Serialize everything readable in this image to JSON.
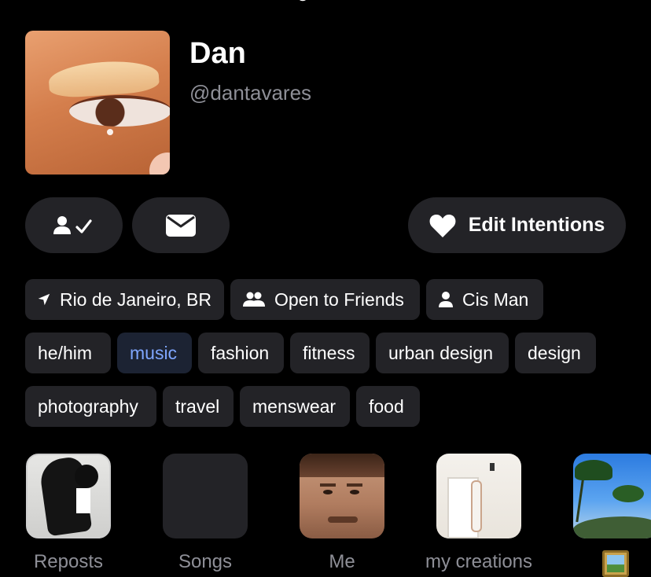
{
  "profile": {
    "name": "Dan",
    "handle": "@dantavares"
  },
  "actions": {
    "edit_intentions_label": "Edit Intentions"
  },
  "icons": {
    "follow": "person-check-icon",
    "message": "envelope-icon",
    "edit_intentions": "heart-icon",
    "location": "location-arrow-icon",
    "friends": "people-icon",
    "gender": "person-icon"
  },
  "info_tags": [
    {
      "label": "Rio de Janeiro, BR"
    },
    {
      "label": "Open to Friends"
    },
    {
      "label": "Cis Man"
    }
  ],
  "interest_tags": [
    {
      "label": "he/him",
      "active": false
    },
    {
      "label": "music",
      "active": true
    },
    {
      "label": "fashion",
      "active": false
    },
    {
      "label": "fitness",
      "active": false
    },
    {
      "label": "urban design",
      "active": false
    },
    {
      "label": "design",
      "active": false
    },
    {
      "label": "photography",
      "active": false
    },
    {
      "label": "travel",
      "active": false
    },
    {
      "label": "menswear",
      "active": false
    },
    {
      "label": "food",
      "active": false
    }
  ],
  "highlights": [
    {
      "label": "Reposts"
    },
    {
      "label": "Songs"
    },
    {
      "label": "Me"
    },
    {
      "label": "my creations"
    },
    {
      "label": ""
    }
  ],
  "colors": {
    "background": "#000000",
    "surface": "#232327",
    "text_primary": "#ffffff",
    "text_secondary": "#8e8f97",
    "active_tag_bg": "#1c2333",
    "active_tag_text": "#7fa6ff"
  }
}
